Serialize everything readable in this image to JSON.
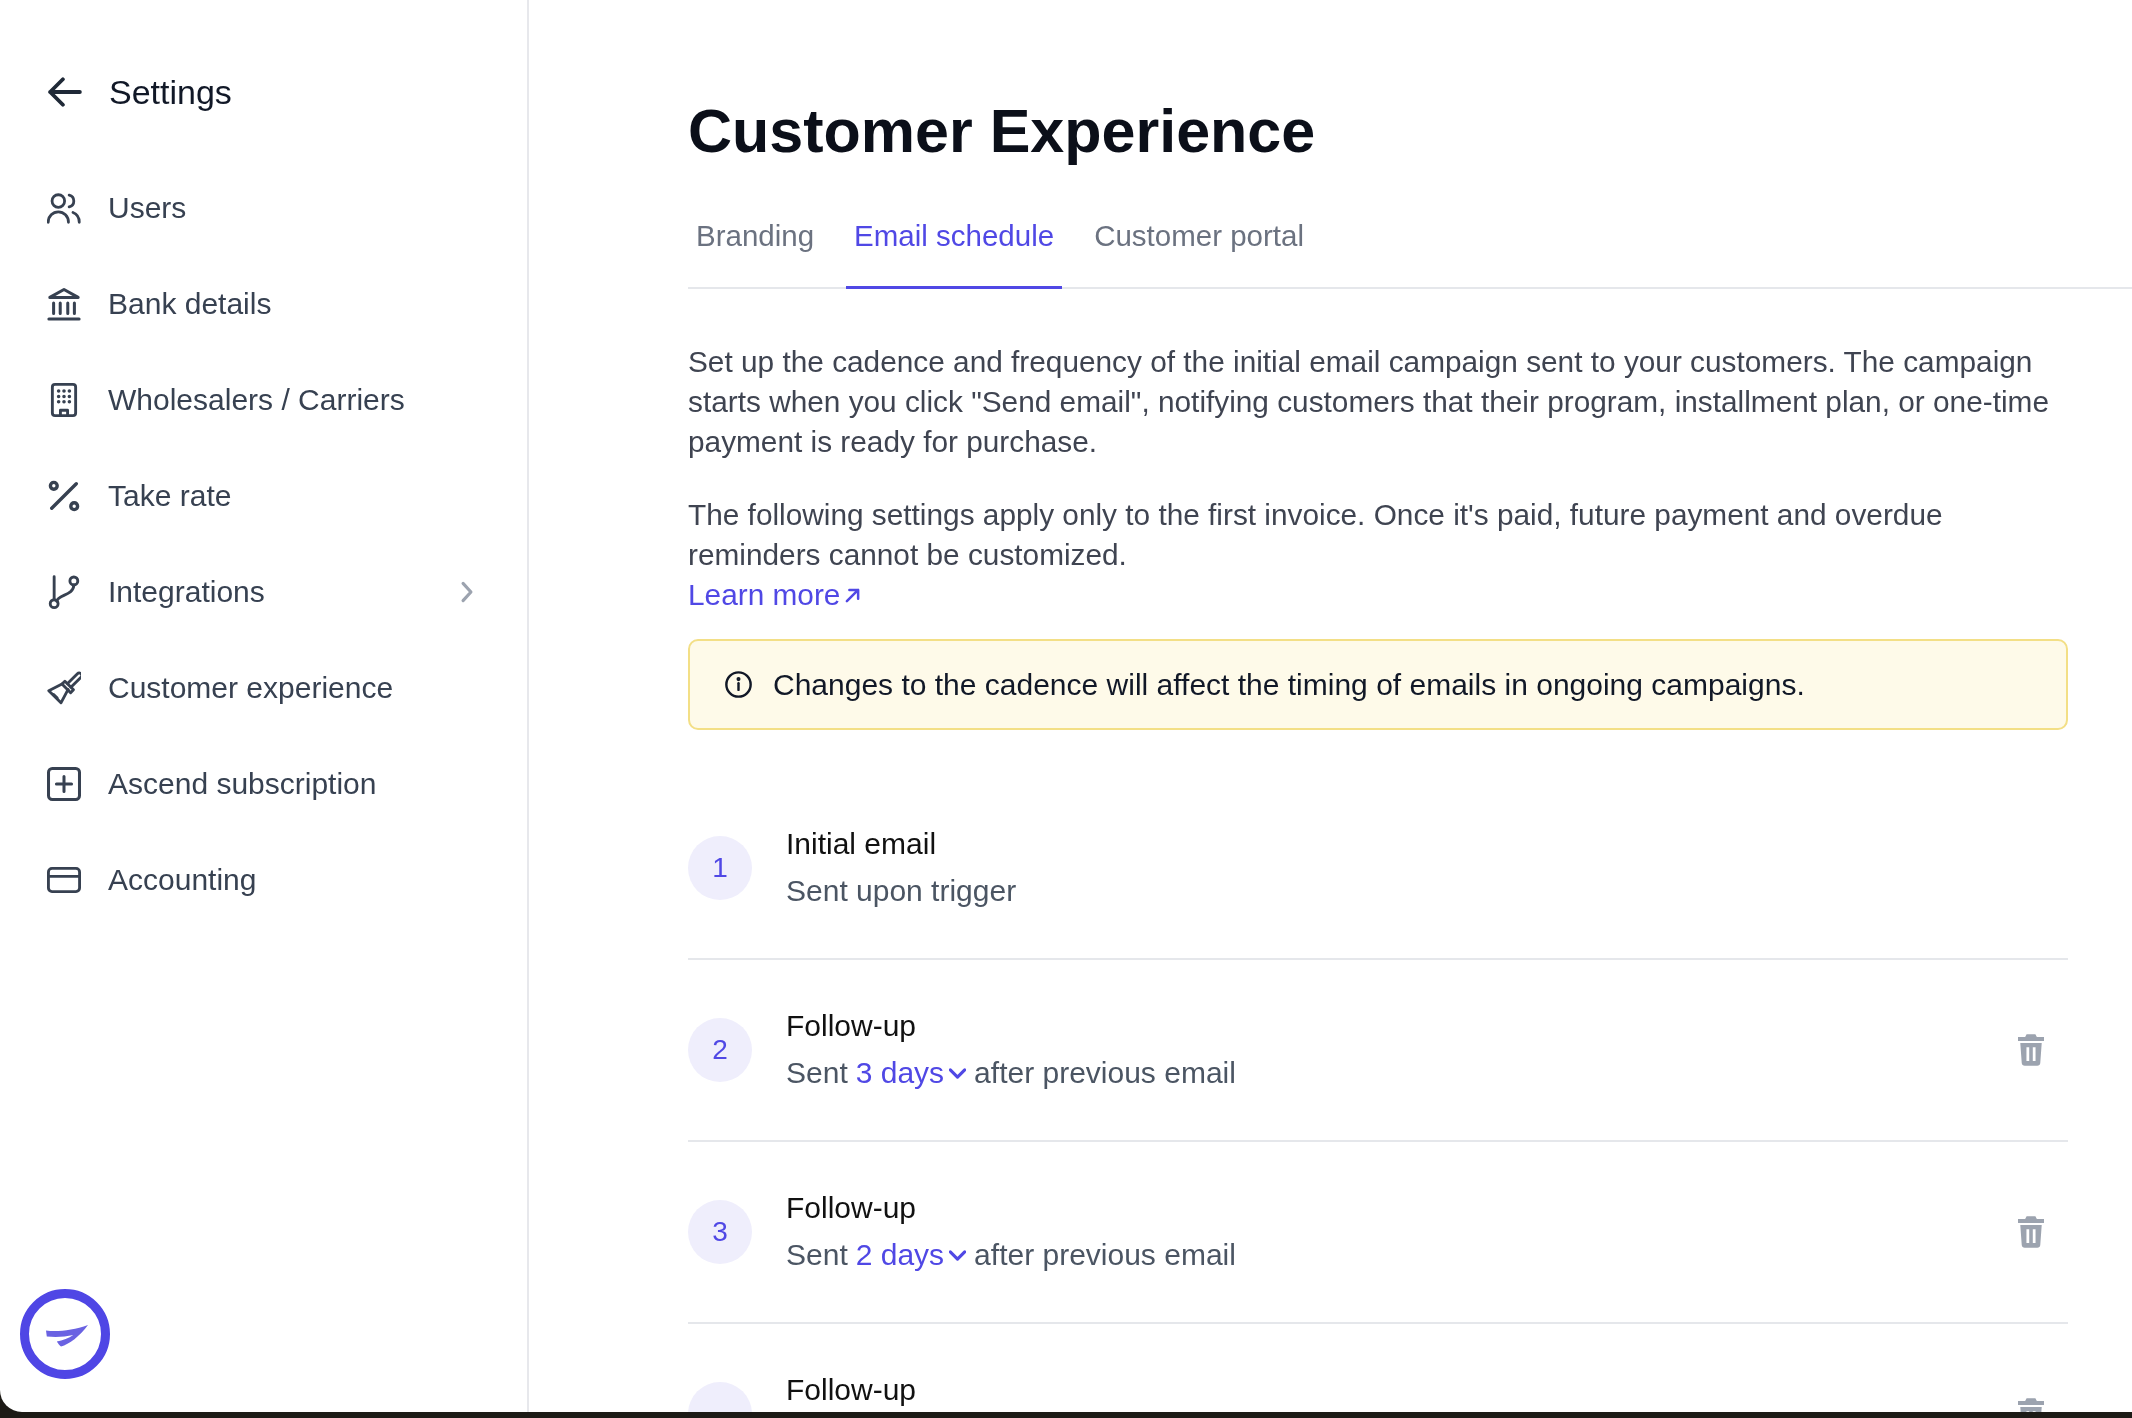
{
  "sidebar": {
    "title": "Settings",
    "items": [
      {
        "label": "Users",
        "submenu": false
      },
      {
        "label": "Bank details",
        "submenu": false
      },
      {
        "label": "Wholesalers / Carriers",
        "submenu": false
      },
      {
        "label": "Take rate",
        "submenu": false
      },
      {
        "label": "Integrations",
        "submenu": true
      },
      {
        "label": "Customer experience",
        "submenu": false
      },
      {
        "label": "Ascend subscription",
        "submenu": false
      },
      {
        "label": "Accounting",
        "submenu": false
      }
    ]
  },
  "page": {
    "title": "Customer Experience",
    "tabs": [
      {
        "label": "Branding",
        "selected": false
      },
      {
        "label": "Email schedule",
        "selected": true
      },
      {
        "label": "Customer portal",
        "selected": false
      }
    ],
    "intro": [
      "Set up the cadence and frequency of the initial email campaign sent to your customers. The campaign starts when you click \"Send email\", notifying customers that their program, installment plan, or one-time payment is ready for purchase.",
      "The following settings apply only to the first invoice. Once it's paid, future payment and overdue reminders cannot be customized."
    ],
    "learn_more": "Learn more",
    "notice": "Changes to the cadence will affect the timing of emails in ongoing campaigns.",
    "emails": [
      {
        "kind": "initial",
        "number": "1",
        "title": "Initial email",
        "subtitle": "Sent upon trigger"
      },
      {
        "kind": "follow_up",
        "number": "2",
        "title": "Follow-up",
        "prefix": "Sent",
        "delay": "3 days",
        "suffix": "after previous email"
      },
      {
        "kind": "follow_up",
        "number": "3",
        "title": "Follow-up",
        "prefix": "Sent",
        "delay": "2 days",
        "suffix": "after previous email"
      },
      {
        "kind": "follow_up",
        "title": "Follow-up"
      }
    ]
  }
}
